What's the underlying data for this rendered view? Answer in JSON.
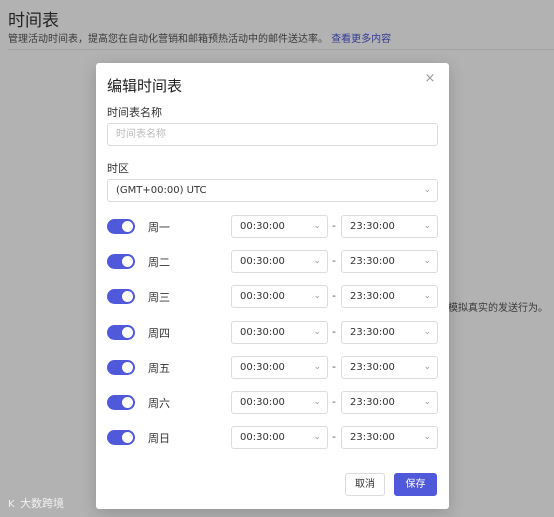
{
  "page": {
    "title": "时间表",
    "description": "管理活动时间表，提高您在自动化营销和邮箱预热活动中的邮件送达率。",
    "more_link": "查看更多内容",
    "behind_text": "模拟真实的发送行为。"
  },
  "watermark": {
    "icon": "K",
    "text": "大数跨境"
  },
  "modal": {
    "title": "编辑时间表",
    "close_symbol": "×",
    "name_label": "时间表名称",
    "name_placeholder": "时间表名称",
    "name_value": "",
    "timezone_label": "时区",
    "timezone_value": "(GMT+00:00) UTC",
    "days": [
      {
        "label": "周一",
        "enabled": true,
        "start": "00:30:00",
        "end": "23:30:00"
      },
      {
        "label": "周二",
        "enabled": true,
        "start": "00:30:00",
        "end": "23:30:00"
      },
      {
        "label": "周三",
        "enabled": true,
        "start": "00:30:00",
        "end": "23:30:00"
      },
      {
        "label": "周四",
        "enabled": true,
        "start": "00:30:00",
        "end": "23:30:00"
      },
      {
        "label": "周五",
        "enabled": true,
        "start": "00:30:00",
        "end": "23:30:00"
      },
      {
        "label": "周六",
        "enabled": true,
        "start": "00:30:00",
        "end": "23:30:00"
      },
      {
        "label": "周日",
        "enabled": true,
        "start": "00:30:00",
        "end": "23:30:00"
      }
    ],
    "range_separator": "-",
    "cancel_label": "取消",
    "save_label": "保存"
  },
  "colors": {
    "accent": "#5059d9",
    "link": "#4a56d6"
  }
}
